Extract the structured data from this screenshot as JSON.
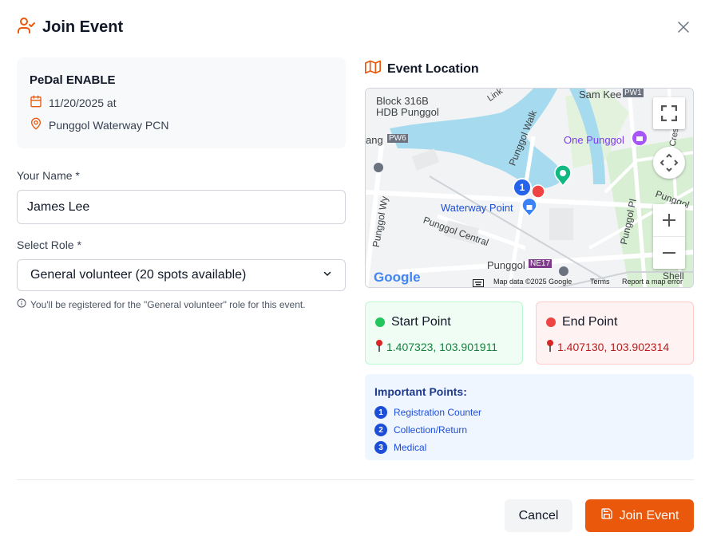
{
  "dialog": {
    "title": "Join Event"
  },
  "event": {
    "name": "PeDal ENABLE",
    "date": "11/20/2025 at",
    "location": "Punggol Waterway PCN"
  },
  "form": {
    "name_label": "Your Name *",
    "name_value": "James Lee",
    "role_label": "Select Role *",
    "role_selected": "General volunteer (20 spots available)",
    "hint": "You'll be registered for the \"General volunteer\" role for this event."
  },
  "location": {
    "title": "Event Location",
    "map": {
      "labels": {
        "block": "Block 316B",
        "hdb": "HDB Punggol",
        "link": "Link",
        "sam_kee": "Sam Kee",
        "pw1": "PW1",
        "ang": "ang",
        "pw6": "PW6",
        "punggol_walk": "Punggol Walk",
        "one_punggol": "One Punggol",
        "punggol_wy": "Punggol Wy",
        "waterway_point": "Waterway Point",
        "punggol_central": "Punggol Central",
        "punggol": "Punggol",
        "ne17": "NE17",
        "punggol_pl": "Punggol Pl",
        "punggol_e": "Punggol",
        "cres": "Cres",
        "shell": "Shell",
        "marker_number": "1"
      },
      "google": "Google",
      "map_data": "Map data ©2025 Google",
      "terms": "Terms",
      "report": "Report a map error"
    },
    "start": {
      "title": "Start Point",
      "coords": "1.407323, 103.901911",
      "color": "#22c55e"
    },
    "end": {
      "title": "End Point",
      "coords": "1.407130, 103.902314",
      "color": "#ef4444"
    }
  },
  "important": {
    "title": "Important Points:",
    "items": [
      {
        "num": "1",
        "label": "Registration Counter"
      },
      {
        "num": "2",
        "label": "Collection/Return"
      },
      {
        "num": "3",
        "label": "Medical"
      }
    ]
  },
  "actions": {
    "cancel": "Cancel",
    "join": "Join Event"
  },
  "colors": {
    "accent": "#ea580c"
  }
}
